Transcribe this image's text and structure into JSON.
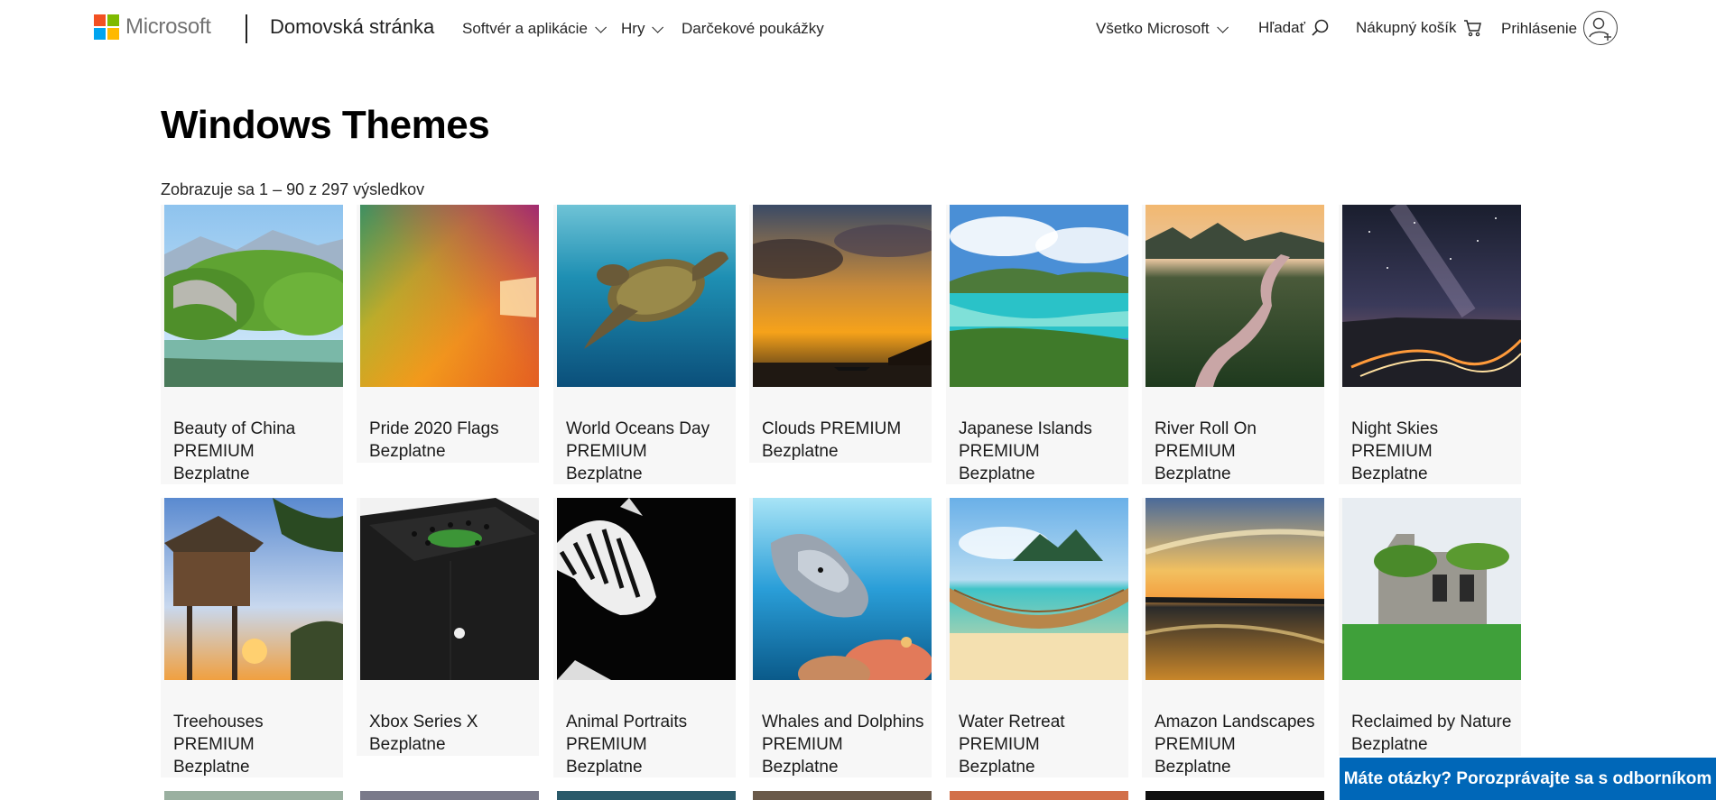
{
  "header": {
    "brand": "Microsoft",
    "home": "Domovská stránka",
    "nav": [
      "Softvér a aplikácie",
      "Hry",
      "Darčekové poukážky"
    ],
    "all_microsoft": "Všetko Microsoft",
    "search": "Hľadať",
    "cart": "Nákupný košík",
    "signin": "Prihlásenie"
  },
  "page": {
    "title": "Windows Themes",
    "results": "Zobrazuje sa 1 – 90 z 297 výsledkov"
  },
  "products": [
    {
      "name": "Beauty of China PREMIUM",
      "price": "Bezplatne"
    },
    {
      "name": "Pride 2020 Flags",
      "price": "Bezplatne"
    },
    {
      "name": "World Oceans Day PREMIUM",
      "price": "Bezplatne"
    },
    {
      "name": "Clouds PREMIUM",
      "price": "Bezplatne"
    },
    {
      "name": "Japanese Islands PREMIUM",
      "price": "Bezplatne"
    },
    {
      "name": "River Roll On PREMIUM",
      "price": "Bezplatne"
    },
    {
      "name": "Night Skies PREMIUM",
      "price": "Bezplatne"
    },
    {
      "name": "Treehouses PREMIUM",
      "price": "Bezplatne"
    },
    {
      "name": "Xbox Series X",
      "price": "Bezplatne"
    },
    {
      "name": "Animal Portraits PREMIUM",
      "price": "Bezplatne"
    },
    {
      "name": "Whales and Dolphins PREMIUM",
      "price": "Bezplatne"
    },
    {
      "name": "Water Retreat PREMIUM",
      "price": "Bezplatne"
    },
    {
      "name": "Amazon Landscapes PREMIUM",
      "price": "Bezplatne"
    },
    {
      "name": "Reclaimed by Nature",
      "price": "Bezplatne"
    }
  ],
  "chat": {
    "label": "Máte otázky? Porozprávajte sa s odborníkom"
  },
  "colors": {
    "accent": "#0067b8",
    "ms_red": "#f25022",
    "ms_green": "#7fba00",
    "ms_blue": "#00a4ef",
    "ms_yellow": "#ffb900"
  }
}
